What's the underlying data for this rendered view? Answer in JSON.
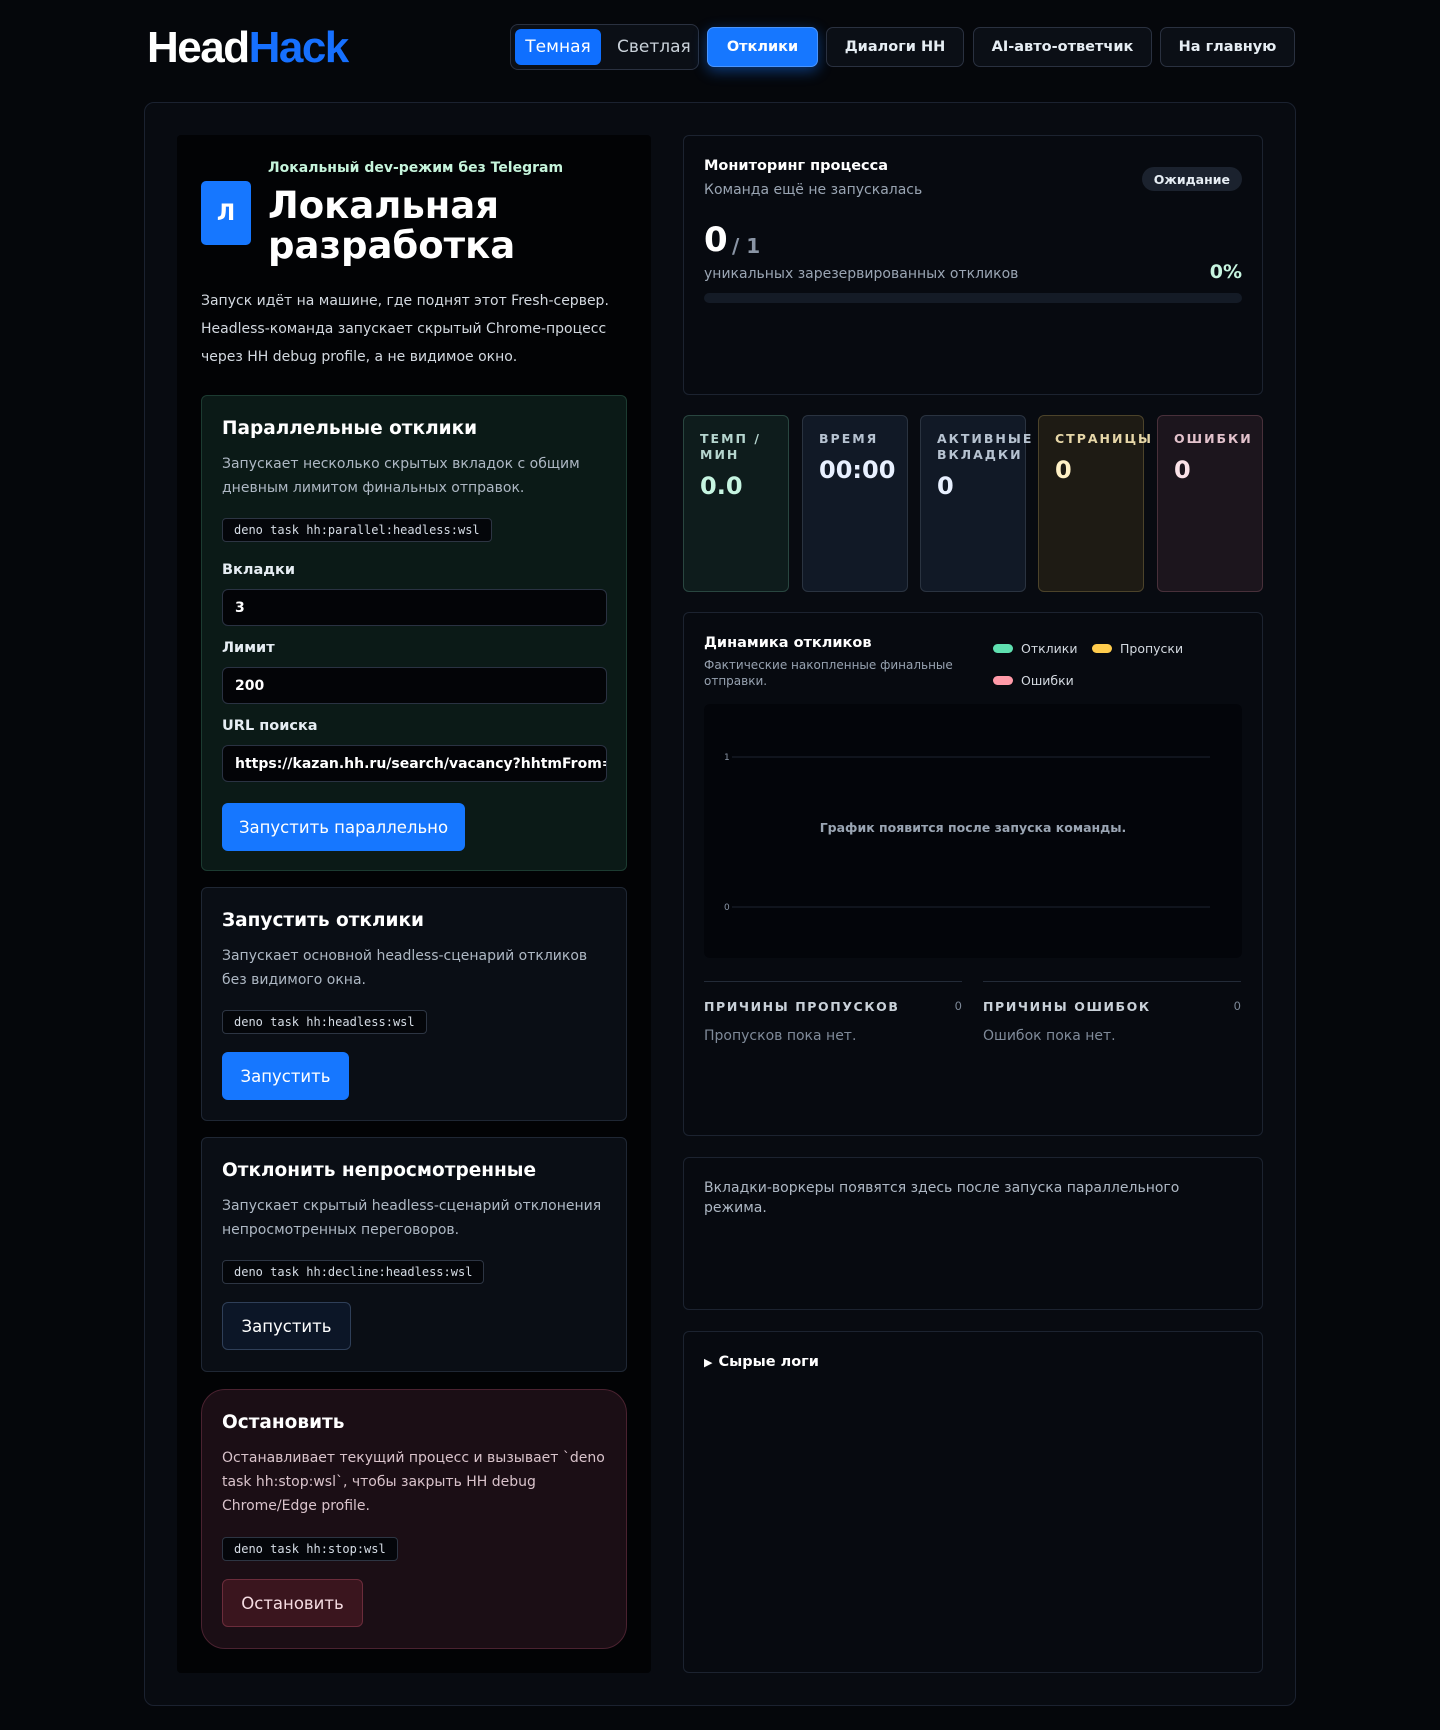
{
  "header": {
    "logo_part1": "Head",
    "logo_part2": "Hack",
    "theme_dark": "Темная",
    "theme_light": "Светлая",
    "nav": [
      "Отклики",
      "Диалоги HH",
      "AI-авто-ответчик",
      "На главную"
    ],
    "active_nav": "Отклики"
  },
  "intro": {
    "avatar_letter": "Л",
    "subtitle": "Локальный dev-режим без Telegram",
    "title": "Локальная разработка",
    "text": "Запуск идёт на машине, где поднят этот Fresh-сервер. Headless-команда запускает скрытый Chrome-процесс через HH debug profile, а не видимое окно."
  },
  "parallel": {
    "title": "Параллельные отклики",
    "desc": "Запускает несколько скрытых вкладок с общим дневным лимитом финальных отправок.",
    "command": "deno task hh:parallel:headless:wsl",
    "tabs_label": "Вкладки",
    "tabs_value": "3",
    "limit_label": "Лимит",
    "limit_value": "200",
    "url_label": "URL поиска",
    "url_value": "https://kazan.hh.ru/search/vacancy?hhtmFrom=main",
    "button": "Запустить параллельно"
  },
  "run": {
    "title": "Запустить отклики",
    "desc": "Запускает основной headless-сценарий откликов без видимого окна.",
    "command": "deno task hh:headless:wsl",
    "button": "Запустить"
  },
  "decline": {
    "title": "Отклонить непросмотренные",
    "desc": "Запускает скрытый headless-сценарий отклонения непросмотренных переговоров.",
    "command": "deno task hh:decline:headless:wsl",
    "button": "Запустить"
  },
  "stop": {
    "title": "Остановить",
    "desc": "Останавливает текущий процесс и вызывает `deno task hh:stop:wsl`, чтобы закрыть HH debug Chrome/Edge profile.",
    "command": "deno task hh:stop:wsl",
    "button": "Остановить"
  },
  "monitor": {
    "title": "Мониторинг процесса",
    "subtitle": "Команда ещё не запускалась",
    "status": "Ожидание",
    "count": "0",
    "total": "/ 1",
    "caption": "уникальных зарезервированных откликов",
    "percent": "0%",
    "progress": 0
  },
  "stats": [
    {
      "label": "ТЕМП / МИН",
      "value": "0.0"
    },
    {
      "label": "ВРЕМЯ",
      "value": "00:00"
    },
    {
      "label": "АКТИВНЫЕ ВКЛАДКИ",
      "value": "0"
    },
    {
      "label": "СТРАНИЦЫ",
      "value": "0"
    },
    {
      "label": "ОШИБКИ",
      "value": "0"
    }
  ],
  "chart": {
    "title": "Динамика откликов",
    "subtitle": "Фактические накопленные финальные отправки.",
    "legend": [
      {
        "name": "Отклики",
        "color": "#5fe0b0"
      },
      {
        "name": "Пропуски",
        "color": "#ffcc4d"
      },
      {
        "name": "Ошибки",
        "color": "#ff9aa8"
      }
    ],
    "y_ticks": [
      "1",
      "0"
    ],
    "empty_message": "График появится после запуска команды.",
    "skip_reasons_title": "ПРИЧИНЫ ПРОПУСКОВ",
    "skip_reasons_count": "0",
    "skip_reasons_empty": "Пропусков пока нет.",
    "error_reasons_title": "ПРИЧИНЫ ОШИБОК",
    "error_reasons_count": "0",
    "error_reasons_empty": "Ошибок пока нет."
  },
  "workers": {
    "text": "Вкладки-воркеры появятся здесь после запуска параллельного режима."
  },
  "logs": {
    "summary": "Сырые логи"
  }
}
